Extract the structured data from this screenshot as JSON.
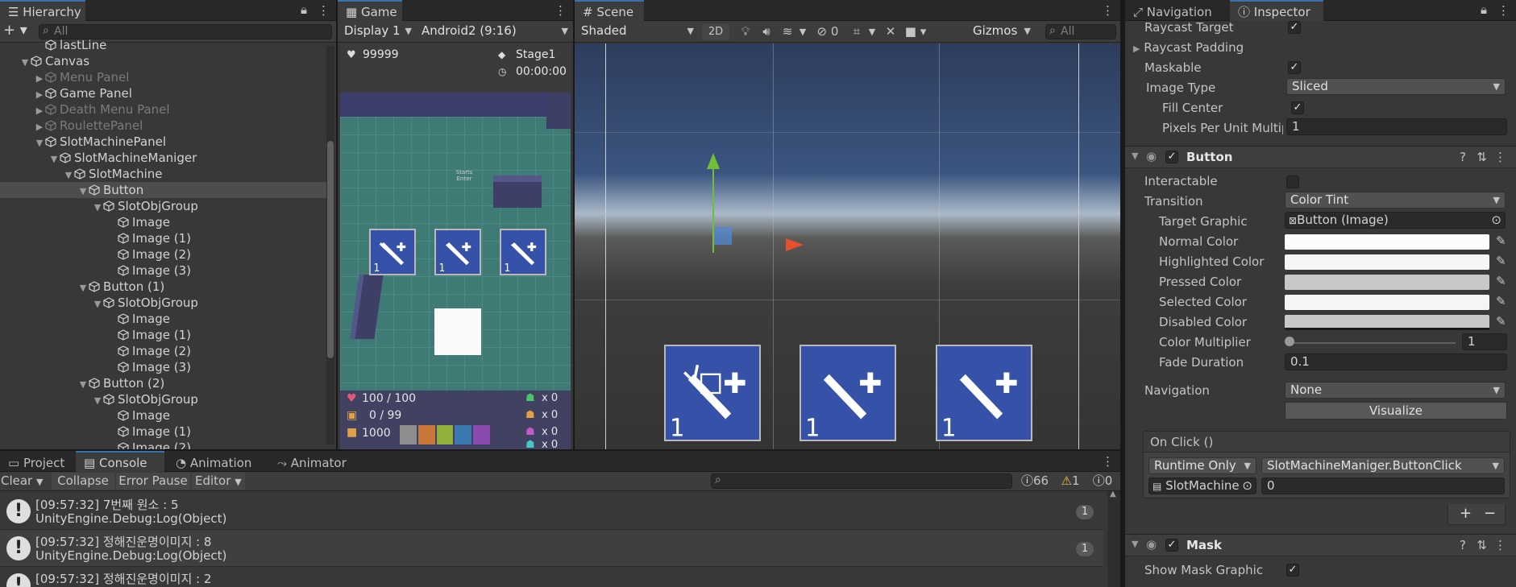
{
  "hierarchy": {
    "tab": "Hierarchy",
    "search_placeholder": "All",
    "rows": [
      {
        "label": "lastLine",
        "depth": 3,
        "arrow": "",
        "dim": false,
        "sel": false
      },
      {
        "label": "Canvas",
        "depth": 2,
        "arrow": "▼",
        "dim": false,
        "sel": false
      },
      {
        "label": "Menu Panel",
        "depth": 3,
        "arrow": "▶",
        "dim": true,
        "sel": false
      },
      {
        "label": "Game Panel",
        "depth": 3,
        "arrow": "▶",
        "dim": false,
        "sel": false
      },
      {
        "label": "Death Menu Panel",
        "depth": 3,
        "arrow": "▶",
        "dim": true,
        "sel": false
      },
      {
        "label": "RoulettePanel",
        "depth": 3,
        "arrow": "▶",
        "dim": true,
        "sel": false
      },
      {
        "label": "SlotMachinePanel",
        "depth": 3,
        "arrow": "▼",
        "dim": false,
        "sel": false
      },
      {
        "label": "SlotMachineManiger",
        "depth": 4,
        "arrow": "▼",
        "dim": false,
        "sel": false
      },
      {
        "label": "SlotMachine",
        "depth": 5,
        "arrow": "▼",
        "dim": false,
        "sel": false
      },
      {
        "label": "Button",
        "depth": 6,
        "arrow": "▼",
        "dim": false,
        "sel": true
      },
      {
        "label": "SlotObjGroup",
        "depth": 7,
        "arrow": "▼",
        "dim": false,
        "sel": false
      },
      {
        "label": "Image",
        "depth": 8,
        "arrow": "",
        "dim": false,
        "sel": false
      },
      {
        "label": "Image (1)",
        "depth": 8,
        "arrow": "",
        "dim": false,
        "sel": false
      },
      {
        "label": "Image (2)",
        "depth": 8,
        "arrow": "",
        "dim": false,
        "sel": false
      },
      {
        "label": "Image (3)",
        "depth": 8,
        "arrow": "",
        "dim": false,
        "sel": false
      },
      {
        "label": "Button (1)",
        "depth": 6,
        "arrow": "▼",
        "dim": false,
        "sel": false
      },
      {
        "label": "SlotObjGroup",
        "depth": 7,
        "arrow": "▼",
        "dim": false,
        "sel": false
      },
      {
        "label": "Image",
        "depth": 8,
        "arrow": "",
        "dim": false,
        "sel": false
      },
      {
        "label": "Image (1)",
        "depth": 8,
        "arrow": "",
        "dim": false,
        "sel": false
      },
      {
        "label": "Image (2)",
        "depth": 8,
        "arrow": "",
        "dim": false,
        "sel": false
      },
      {
        "label": "Image (3)",
        "depth": 8,
        "arrow": "",
        "dim": false,
        "sel": false
      },
      {
        "label": "Button (2)",
        "depth": 6,
        "arrow": "▼",
        "dim": false,
        "sel": false
      },
      {
        "label": "SlotObjGroup",
        "depth": 7,
        "arrow": "▼",
        "dim": false,
        "sel": false
      },
      {
        "label": "Image",
        "depth": 8,
        "arrow": "",
        "dim": false,
        "sel": false
      },
      {
        "label": "Image (1)",
        "depth": 8,
        "arrow": "",
        "dim": false,
        "sel": false
      },
      {
        "label": "Image (2)",
        "depth": 8,
        "arrow": "",
        "dim": false,
        "sel": false
      }
    ]
  },
  "game": {
    "tab": "Game",
    "display": "Display 1",
    "aspect": "Android2 (9:16)",
    "hud": {
      "currency": "99999",
      "stage": "Stage1",
      "time": "00:00:00",
      "hp": "100 / 100",
      "bag": "0 / 99",
      "gold": "1000",
      "enemy_counts": [
        "x 0",
        "x 0",
        "x 0",
        "x 0"
      ],
      "slot_text": "Starts Enter"
    }
  },
  "scene": {
    "tab": "Scene",
    "shading": "Shaded",
    "mode_2d": "2D",
    "hidden_count": "0",
    "gizmos": "Gizmos",
    "search_placeholder": "All",
    "slot_number": "1"
  },
  "inspector": {
    "tabs": [
      "Navigation",
      "Inspector"
    ],
    "image": {
      "raycast_target": "Raycast Target",
      "raycast_padding": "Raycast Padding",
      "maskable": "Maskable",
      "image_type_label": "Image Type",
      "image_type": "Sliced",
      "fill_center": "Fill Center",
      "ppu_label": "Pixels Per Unit Multipl",
      "ppu": "1"
    },
    "button": {
      "title": "Button",
      "interactable": "Interactable",
      "transition_label": "Transition",
      "transition": "Color Tint",
      "target_graphic_label": "Target Graphic",
      "target_graphic": "Button (Image)",
      "normal": "Normal Color",
      "highlighted": "Highlighted Color",
      "pressed": "Pressed Color",
      "selected": "Selected Color",
      "disabled": "Disabled Color",
      "multiplier_label": "Color Multiplier",
      "multiplier": "1",
      "fade_label": "Fade Duration",
      "fade": "0.1",
      "navigation_label": "Navigation",
      "navigation": "None",
      "visualize": "Visualize",
      "onclick": "On Click ()",
      "runtime": "Runtime Only",
      "function": "SlotMachineManiger.ButtonClick",
      "object": "SlotMachine",
      "arg": "0",
      "add": "+",
      "remove": "−"
    },
    "mask": {
      "title": "Mask",
      "show_graphic": "Show Mask Graphic"
    }
  },
  "bottom": {
    "tabs": [
      "Project",
      "Console",
      "Animation",
      "Animator"
    ],
    "clear": "Clear",
    "collapse": "Collapse",
    "error_pause": "Error Pause",
    "editor": "Editor",
    "log_count": "66",
    "warn_count": "1",
    "err_count": "0",
    "entries": [
      {
        "line1": "[09:57:32] 7번째 원소 : 5",
        "line2": "UnityEngine.Debug:Log(Object)",
        "count": "1"
      },
      {
        "line1": "[09:57:32] 정해진운명이미지 : 8",
        "line2": "UnityEngine.Debug:Log(Object)",
        "count": "1"
      },
      {
        "line1": "[09:57:32] 정해진운명이미지 : 2",
        "line2": "",
        "count": ""
      }
    ]
  },
  "colors": {
    "accent": "#3a72b0",
    "slot_blue": "#3551a8",
    "selected_row": "#4d4d4d"
  }
}
